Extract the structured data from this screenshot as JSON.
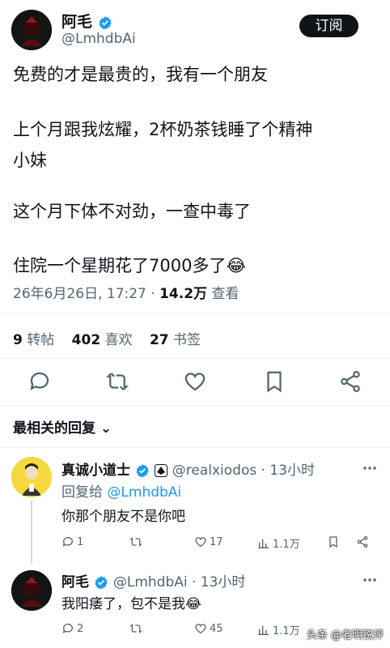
{
  "author": {
    "name": "阿毛",
    "handle": "@LmhdbAi"
  },
  "subscribe_label": "订阅",
  "post": {
    "lines": [
      "免费的才是最贵的，我有一个朋友",
      "上个月跟我炫耀，2杯奶茶钱睡了个精神",
      "小妹",
      "这个月下体不对劲，一查中毒了",
      "住院一个星期花了7000多了😂"
    ],
    "meta_time": "26年6月26日, 17:27 · ",
    "views_count": "14.2万",
    "views_label": "查看"
  },
  "stats": {
    "reposts_count": "9",
    "reposts_label": "转帖",
    "likes_count": "402",
    "likes_label": "喜欢",
    "bookmarks_count": "27",
    "bookmarks_label": "书签"
  },
  "sort_label": "最相关的回复 ⌄",
  "replies": [
    {
      "name": "真诚小道士",
      "handle": "@realxiodos · 13小时",
      "reply_to_prefix": "回复给",
      "reply_to": "@LmhdbAi",
      "text": "你那个朋友不是你吧",
      "reply_count": "1",
      "repost_count": "",
      "like_count": "17",
      "views": "1.1万"
    },
    {
      "name": "阿毛",
      "handle": "@LmhdbAi · 13小时",
      "text": "我阳痿了，包不是我😂",
      "reply_count": "2",
      "repost_count": "",
      "like_count": "45",
      "views": "1.1万"
    }
  ],
  "watermark": "头条 @老明锐评",
  "colors": {
    "verified": "#1d9bf0",
    "link": "#1d9bf0",
    "muted": "#536471"
  }
}
